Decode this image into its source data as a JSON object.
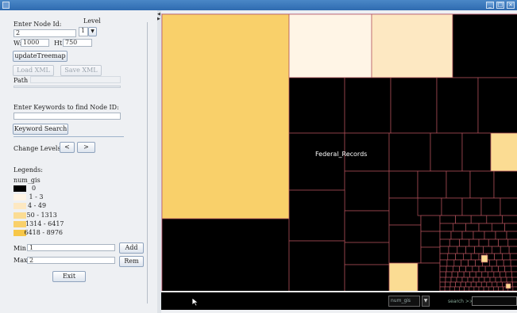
{
  "window": {
    "minimize_glyph": "_",
    "maximize_glyph": "□",
    "close_glyph": "×"
  },
  "controls": {
    "node_id_label": "Enter Node Id:",
    "node_id_value": "2",
    "level_label": "Level",
    "level_value": "1",
    "width_label": "W:",
    "width_value": "1000",
    "height_label": "Ht:",
    "height_value": "750",
    "update_button": "updateTreemap",
    "load_xml_button": "Load XML",
    "save_xml_button": "Save XML",
    "path_label": "Path",
    "keywords_label": "Enter Keywords to find Node ID:",
    "keywords_value": "",
    "keyword_search_button": "Keyword Search",
    "change_levels_label": "Change Levels",
    "prev_level_button": "<",
    "next_level_button": ">"
  },
  "legend": {
    "title": "Legends:",
    "metric": "num_gis",
    "entries": [
      {
        "range": "0",
        "color": "#000000"
      },
      {
        "range": "1 - 3",
        "color": "#fff5e6"
      },
      {
        "range": "4 - 49",
        "color": "#fde8c2"
      },
      {
        "range": "50 - 1313",
        "color": "#fbdc93"
      },
      {
        "range": "1314 - 6417",
        "color": "#f9d06a"
      },
      {
        "range": "6418 - 8976",
        "color": "#f7c748"
      }
    ]
  },
  "filter": {
    "min_label": "Min",
    "min_value": "1",
    "max_label": "Max",
    "max_value": "2",
    "add_button": "Add",
    "rem_button": "Rem",
    "exit_button": "Exit"
  },
  "treemap": {
    "label": "Federal_Records",
    "border_color": "#b0505a"
  },
  "bottombar": {
    "metric_select": "num_gis",
    "search_label": "search >>",
    "search_value": ""
  }
}
